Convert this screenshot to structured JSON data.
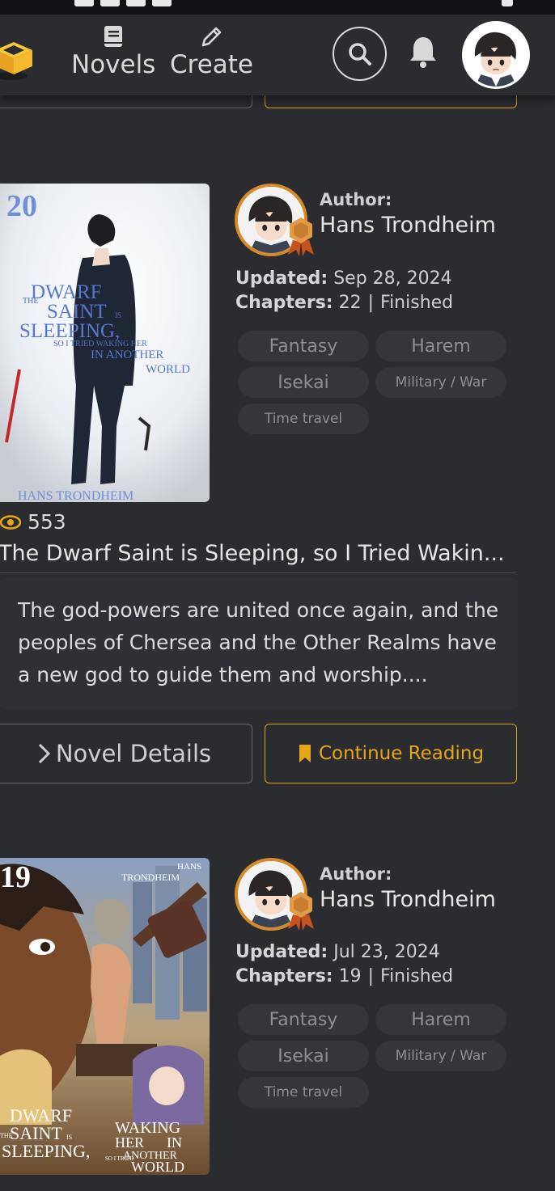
{
  "nav": {
    "novels_label": "Novels",
    "create_label": "Create"
  },
  "novels": [
    {
      "cover_number": "20",
      "cover_title_lines": [
        "THE",
        "DWARF",
        "SAINT",
        "IS",
        "SLEEPING,",
        "SO I TRIED WAKING HER",
        "IN ANOTHER",
        "WORLD"
      ],
      "cover_author": "HANS TRONDHEIM",
      "author_label": "Author:",
      "author_name": "Hans Trondheim",
      "updated_label": "Updated:",
      "updated_value": "Sep 28, 2024",
      "chapters_label": "Chapters:",
      "chapters_value": "22",
      "separator": "|",
      "status": "Finished",
      "tags": [
        "Fantasy",
        "Harem",
        "Isekai",
        "Military / War",
        "Time travel"
      ],
      "views": "553",
      "title": "The Dwarf Saint is Sleeping, so I Tried Wakin...",
      "description": "The god-powers are united once again, and the peoples of Chersea and the Other Realms have a new god to guide them and worship....",
      "details_label": "Novel Details",
      "continue_label": "Continue Reading"
    },
    {
      "cover_number": "19",
      "cover_author_lines": [
        "HANS",
        "TRONDHEIM"
      ],
      "cover_title_lines": [
        "THE",
        "DWARF",
        "SAINT",
        "IS",
        "SLEEPING,",
        "SO I TRIED",
        "WAKING",
        "HER",
        "IN",
        "ANOTHER",
        "WORLD"
      ],
      "author_label": "Author:",
      "author_name": "Hans Trondheim",
      "updated_label": "Updated:",
      "updated_value": "Jul 23, 2024",
      "chapters_label": "Chapters:",
      "chapters_value": "19",
      "separator": "|",
      "status": "Finished",
      "tags": [
        "Fantasy",
        "Harem",
        "Isekai",
        "Military / War",
        "Time travel"
      ]
    }
  ],
  "colors": {
    "background": "#2b2c30",
    "accent": "#d9a21b",
    "author_ring": "#d68a2a"
  }
}
